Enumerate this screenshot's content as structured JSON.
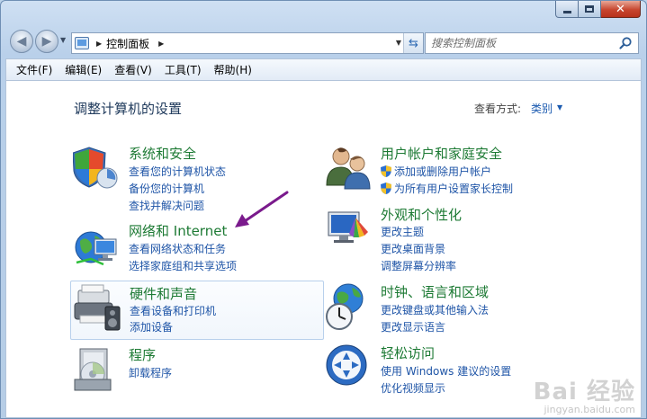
{
  "window": {
    "caption_buttons": [
      "minimize",
      "maximize",
      "close"
    ]
  },
  "nav": {
    "address_parts": [
      "控制面板"
    ],
    "search_placeholder": "搜索控制面板"
  },
  "menu": [
    "文件(F)",
    "编辑(E)",
    "查看(V)",
    "工具(T)",
    "帮助(H)"
  ],
  "main": {
    "heading": "调整计算机的设置",
    "view_by_label": "查看方式:",
    "view_by_value": "类别"
  },
  "categories": [
    {
      "title": "系统和安全",
      "icon": "system-security-icon",
      "links": [
        "查看您的计算机状态",
        "备份您的计算机",
        "查找并解决问题"
      ]
    },
    {
      "title": "网络和 Internet",
      "icon": "network-internet-icon",
      "links": [
        "查看网络状态和任务",
        "选择家庭组和共享选项"
      ]
    },
    {
      "title": "硬件和声音",
      "icon": "hardware-sound-icon",
      "links": [
        "查看设备和打印机",
        "添加设备"
      ]
    },
    {
      "title": "程序",
      "icon": "programs-icon",
      "links": [
        "卸载程序"
      ]
    },
    {
      "title": "用户帐户和家庭安全",
      "icon": "user-accounts-icon",
      "links": [
        "添加或删除用户帐户",
        "为所有用户设置家长控制"
      ]
    },
    {
      "title": "外观和个性化",
      "icon": "appearance-icon",
      "links": [
        "更改主题",
        "更改桌面背景",
        "调整屏幕分辨率"
      ]
    },
    {
      "title": "时钟、语言和区域",
      "icon": "clock-language-icon",
      "links": [
        "更改键盘或其他输入法",
        "更改显示语言"
      ]
    },
    {
      "title": "轻松访问",
      "icon": "ease-of-access-icon",
      "links": [
        "使用 Windows 建议的设置",
        "优化视频显示"
      ]
    }
  ],
  "watermark": {
    "logo": "Bai 经验",
    "url": "jingyan.baidu.com"
  },
  "colors": {
    "title_green": "#1d7a34",
    "link_blue": "#1f55a7",
    "annotation_arrow": "#7a1a8c"
  }
}
